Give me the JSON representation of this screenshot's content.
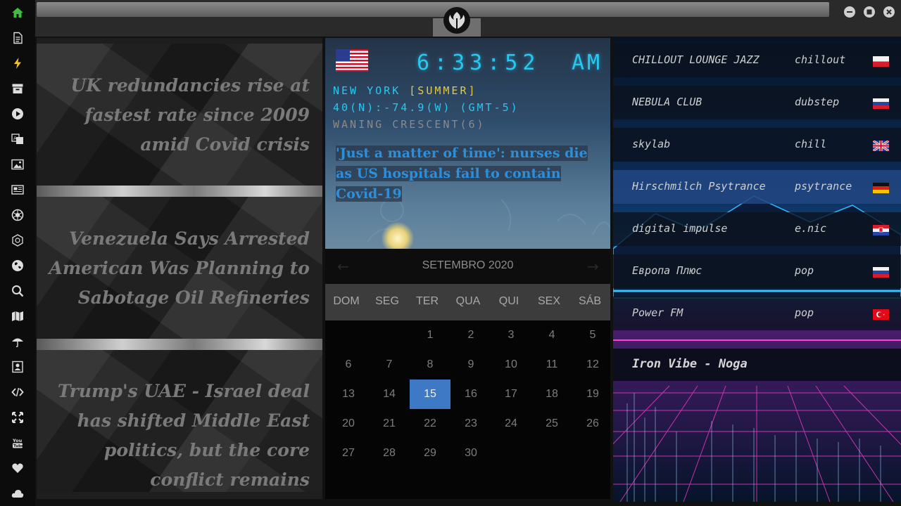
{
  "sidebar": {
    "icons": [
      "home-icon",
      "document-icon",
      "lightning-icon",
      "archive-icon",
      "play-icon",
      "translate-icon",
      "image-icon",
      "newspaper-icon",
      "rebel-alliance-icon",
      "empire-icon",
      "globe-icon",
      "search-icon",
      "map-icon",
      "umbrella-icon",
      "contact-card-icon",
      "code-icon",
      "expand-icon",
      "youtube-icon",
      "heart-icon",
      "cloud-icon"
    ],
    "accent": "#3fbf3f"
  },
  "news": {
    "headlines": [
      "UK redundancies rise at fastest rate since 2009 amid Covid crisis",
      "Venezuela Says Arrested American Was Planning to Sabotage Oil Refineries",
      "Trump's UAE - Israel deal has shifted Middle East politics, but the core conflict remains"
    ]
  },
  "clock": {
    "time": "6:33:52",
    "ampm": "AM",
    "city": "NEW YORK",
    "season": "[SUMMER]",
    "coords": "40(N):-74.9(W) (GMT-5)",
    "moon": "WANING CRESCENT(6)",
    "headline": "'Just a matter of time': nurses die as US hospitals fail to contain Covid-19",
    "colors": {
      "digits": "#29c7f0",
      "season": "#e2c84a"
    }
  },
  "calendar": {
    "month": "SETEMBRO 2020",
    "prev": "←",
    "next": "→",
    "weekdays": [
      "DOM",
      "SEG",
      "TER",
      "QUA",
      "QUI",
      "SEX",
      "SÁB"
    ],
    "weeks": [
      [
        "",
        "",
        "1",
        "2",
        "3",
        "4",
        "5"
      ],
      [
        "6",
        "7",
        "8",
        "9",
        "10",
        "11",
        "12"
      ],
      [
        "13",
        "14",
        "15",
        "16",
        "17",
        "18",
        "19"
      ],
      [
        "20",
        "21",
        "22",
        "23",
        "24",
        "25",
        "26"
      ],
      [
        "27",
        "28",
        "29",
        "30",
        "",
        "",
        ""
      ]
    ],
    "today": "15"
  },
  "radio": {
    "stations": [
      {
        "name": "CHILLOUT LOUNGE JAZZ",
        "genre": "chillout",
        "flag": "PL"
      },
      {
        "name": "NEBULA CLUB",
        "genre": "dubstep",
        "flag": "RU"
      },
      {
        "name": "skylab",
        "genre": "chill",
        "flag": "GB"
      },
      {
        "name": "Hirschmilch Psytrance",
        "genre": "psytrance",
        "flag": "DE"
      },
      {
        "name": "digital impulse",
        "genre": "e.nic",
        "flag": "HR"
      },
      {
        "name": "Европа Плюс",
        "genre": "pop",
        "flag": "RU"
      },
      {
        "name": "Power FM",
        "genre": "pop",
        "flag": "TR"
      }
    ],
    "active_index": 3,
    "now_playing": "Iron Vibe - Noga"
  }
}
